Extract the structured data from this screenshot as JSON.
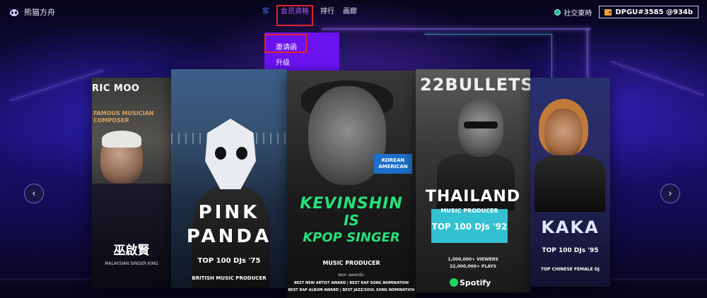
{
  "brand": {
    "name": "熊猫方舟",
    "logo_icon": "panda-icon"
  },
  "nav": {
    "items": [
      {
        "label": "家",
        "active": true
      },
      {
        "label": "会员资格",
        "active": false
      },
      {
        "label": "排行",
        "active": false
      },
      {
        "label": "画廊",
        "active": false
      }
    ]
  },
  "header": {
    "community_label": "社交東時",
    "wallet_label": "DPGU#3585 @934b"
  },
  "dropdown": {
    "items": [
      {
        "label": "邀请函"
      },
      {
        "label": "升级"
      }
    ]
  },
  "cards": [
    {
      "title": "RIC MOO",
      "subtitle_1": "FAMOUS MUSICIAN",
      "subtitle_2": "COMPOSER",
      "name": "巫啟賢",
      "tag": "MALAYSIAN SINGER KING"
    },
    {
      "line1": "PINK",
      "line2": "PANDA",
      "top100": "TOP 100 DJs '75",
      "caption": "BRITISH MUSIC PRODUCER"
    },
    {
      "chip": "KOREAN AMERICAN",
      "neon1": "KEVINSHIN",
      "neon2": "IS",
      "neon3": "KPOP SINGER",
      "role": "MUSIC PRODUCER",
      "won": "won awards:",
      "awards1": "BEST NEW ARTIST AWARD  |  BEST RAP SONG NOMINATION",
      "awards2": "BEST RAP ALBUM AWARD  |  BEST JAZZ/SOUL SONG NOMINATION"
    },
    {
      "title": "22BULLETS",
      "country": "THAILAND",
      "role": "MUSIC PRODUCER",
      "top100": "TOP 100 DJs '92",
      "views": "1,000,000+ VIEWERS",
      "plays": "22,000,000+ PLAYS",
      "platform": "Spotify"
    },
    {
      "name": "KAKA",
      "top100": "TOP 100 DJs '95",
      "caption": "TOP CHINESE FEMALE DJ"
    }
  ],
  "carousel": {
    "prev_icon": "chevron-left-icon",
    "next_icon": "chevron-right-icon"
  },
  "colors": {
    "accent": "#6a12f0",
    "highlight_red": "#e0252a",
    "nav_active": "#4a6bff"
  }
}
